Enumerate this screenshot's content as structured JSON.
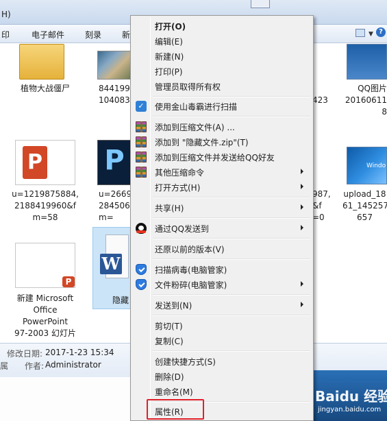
{
  "window": {
    "menu_help": "H)"
  },
  "toolbar": {
    "items": [
      "印",
      "电子邮件",
      "刻录",
      "新"
    ]
  },
  "files": [
    {
      "label": "植物大战僵尸"
    },
    {
      "label": "8441994\n1040832"
    },
    {
      "label": "423"
    },
    {
      "label": "QQ图片\n20160611\n8"
    },
    {
      "label": "u=1219875884,\n2188419960&f\nm=58"
    },
    {
      "label": "u=2669\n284506\nm="
    },
    {
      "label": "987,\n&f\n=0"
    },
    {
      "label": "upload_18\n61_145257\n657"
    },
    {
      "label": "新建 Microsoft\nOffice\nPowerPoint\n97-2003 幻灯片"
    },
    {
      "label": "隐藏"
    }
  ],
  "icons": {
    "ppt_badge": "P",
    "ps_letter": "P",
    "word_letter": "W",
    "win7_text": "Windo"
  },
  "details": {
    "modified_label": "修改日期:",
    "modified_value": "2017-1-23 15:34",
    "author_label": "作者:",
    "author_value": "Administrator",
    "left_fragment": "属"
  },
  "context_menu": {
    "items": [
      {
        "label": "打开(O)",
        "bold": true
      },
      {
        "label": "编辑(E)"
      },
      {
        "label": "新建(N)"
      },
      {
        "label": "打印(P)"
      },
      {
        "label": "管理员取得所有权"
      },
      {
        "label": "使用金山毒霸进行扫描",
        "icon": "jinshan-icon"
      },
      {
        "label": "添加到压缩文件(A) ...",
        "icon": "winrar-icon"
      },
      {
        "label": "添加到 \"隐藏文件.zip\"(T)",
        "icon": "winrar-icon"
      },
      {
        "label": "添加到压缩文件并发送给QQ好友",
        "icon": "winrar-icon"
      },
      {
        "label": "其他压缩命令",
        "icon": "winrar-icon",
        "submenu": true
      },
      {
        "label": "打开方式(H)",
        "submenu": true
      },
      {
        "label": "共享(H)",
        "submenu": true
      },
      {
        "label": "通过QQ发送到",
        "icon": "qq-icon",
        "submenu": true
      },
      {
        "label": "还原以前的版本(V)"
      },
      {
        "label": "扫描病毒(电脑管家)",
        "icon": "tencent-shield-icon"
      },
      {
        "label": "文件粉碎(电脑管家)",
        "icon": "tencent-shield-icon",
        "submenu": true
      },
      {
        "label": "发送到(N)",
        "submenu": true
      },
      {
        "label": "剪切(T)"
      },
      {
        "label": "复制(C)"
      },
      {
        "label": "创建快捷方式(S)"
      },
      {
        "label": "删除(D)"
      },
      {
        "label": "重命名(M)"
      },
      {
        "label": "属性(R)"
      }
    ]
  },
  "watermark": {
    "brand": "Baidu 经验",
    "url": "jingyan.baidu.com"
  },
  "colors": {
    "highlight_border": "#e0202a",
    "menu_background": "#f0f0f0"
  }
}
